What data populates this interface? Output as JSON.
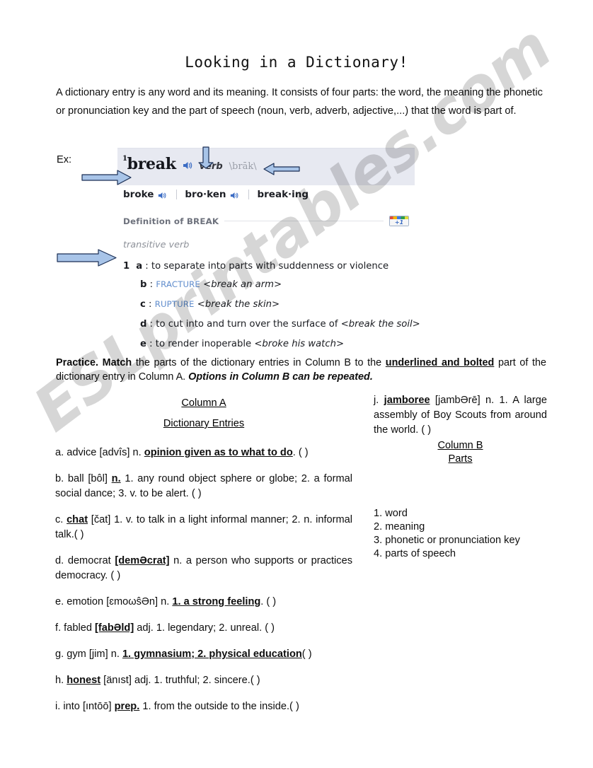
{
  "page": {
    "title": "Looking in a Dictionary!",
    "intro": "A dictionary entry is any word and its meaning. It consists of four parts: the word, the meaning the phonetic or pronunciation key and the part of speech (noun, verb, adverb, adjective,...) that the word is part of.",
    "example_label": "Ex:",
    "watermark": "ESLprintables.com"
  },
  "dictionary": {
    "headword": "break",
    "headword_superscript": "1",
    "part_of_speech": "verb",
    "phonetic": "\\brāk\\",
    "speaker_icon": "speaker-icon",
    "inflections": [
      "broke",
      "bro·ken",
      "break·ing"
    ],
    "definition_heading": "Definition of BREAK",
    "plus_one_label": "+1",
    "verb_type": "transitive verb",
    "senses": [
      {
        "num": "1",
        "letter": "a",
        "xref": "",
        "text": ": to separate into parts with suddenness or violence",
        "example": ""
      },
      {
        "num": "",
        "letter": "b",
        "xref": "FRACTURE",
        "text": ":",
        "example": "<break an arm>"
      },
      {
        "num": "",
        "letter": "c",
        "xref": "RUPTURE",
        "text": ":",
        "example": "<break the skin>"
      },
      {
        "num": "",
        "letter": "d",
        "xref": "",
        "text": ": to cut into and turn over the surface of",
        "example": "<break the soil>"
      },
      {
        "num": "",
        "letter": "e",
        "xref": "",
        "text": ": to render inoperable",
        "example": "<broke his watch>"
      }
    ],
    "annotations": [
      {
        "name": "arrow-pointing-to-word",
        "direction": "right"
      },
      {
        "name": "arrow-pointing-to-part-of-speech",
        "direction": "down"
      },
      {
        "name": "arrow-pointing-to-phonetic-key",
        "direction": "left"
      },
      {
        "name": "arrow-pointing-to-meaning",
        "direction": "right"
      }
    ]
  },
  "practice": {
    "lead_bold_1": "Practice.",
    "lead_bold_2": "Match",
    "text_1": " the parts of the dictionary entries in Column B to the ",
    "underlined_bold": "underlined and bolted",
    "text_2": " part of the dictionary entry in Column A. ",
    "italic_bold": "Options in Column B can be repeated."
  },
  "column_a": {
    "heading": "Column A",
    "subheading": "Dictionary Entries",
    "entries": [
      {
        "id": "a",
        "word": "advice",
        "phonetic": "[advîs]",
        "pos": "n.",
        "definition": "opinion given as to what to do",
        "blank": "(     )"
      },
      {
        "id": "b",
        "word": "ball",
        "phonetic": "[bôl]",
        "pos": "n.",
        "definition": "1. any round object sphere or globe; 2. a formal social dance; 3. v. to be alert.",
        "blank": "(     )"
      },
      {
        "id": "c",
        "word": "chat",
        "phonetic": "[čat]",
        "pos": "",
        "definition": "1. v. to talk in a light informal manner; 2. n. informal talk.",
        "blank": "(     )"
      },
      {
        "id": "d",
        "word": "democrat",
        "phonetic": "[demƏcrat]",
        "pos": "n.",
        "definition": "a person who supports or practices democracy.",
        "blank": "(     )"
      },
      {
        "id": "e",
        "word": "emotion",
        "phonetic": "[ɛmoωŝƏn]",
        "pos": "n.",
        "definition": "1. a strong feeling",
        "blank": "(     )"
      },
      {
        "id": "f",
        "word": "fabled",
        "phonetic": "[fabƏld]",
        "pos": "adj.",
        "definition": "1. legendary; 2. unreal.",
        "blank": "(     )"
      },
      {
        "id": "g",
        "word": "gym",
        "phonetic": "[jim]",
        "pos": "n.",
        "definition": "1. gymnasium; 2. physical education",
        "blank": "(     )"
      },
      {
        "id": "h",
        "word": "honest",
        "phonetic": "[änıst]",
        "pos": "adj.",
        "definition": "1. truthful; 2. sincere.",
        "blank": "(     )"
      },
      {
        "id": "i",
        "word": "into",
        "phonetic": "[ıntōō]",
        "pos": "prep.",
        "definition": "1. from the outside to the inside.",
        "blank": "(     )"
      },
      {
        "id": "j",
        "word": "jamboree",
        "phonetic": "[jambƏrē]",
        "pos": "n.",
        "definition": "1. A large assembly of Boy Scouts from around the world.",
        "blank": "(     )"
      }
    ]
  },
  "column_b": {
    "heading": "Column B",
    "subheading": "Parts",
    "items": [
      "1. word",
      "2. meaning",
      "3. phonetic or pronunciation key",
      "4. parts of speech"
    ]
  }
}
